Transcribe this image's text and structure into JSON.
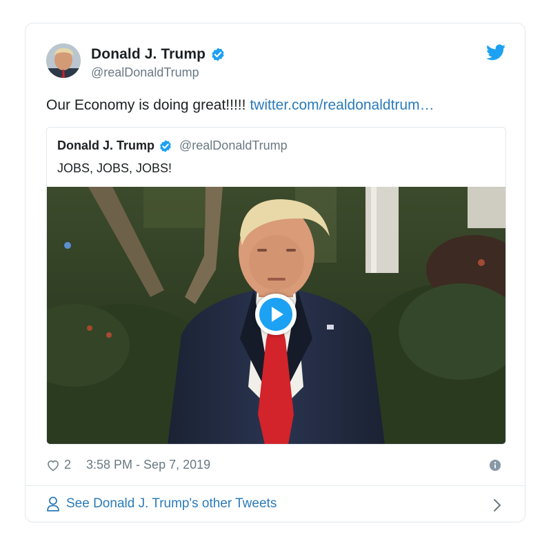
{
  "tweet": {
    "author_name": "Donald J. Trump",
    "author_handle": "@realDonaldTrump",
    "text": "Our Economy is doing great!!!!! ",
    "link_text": "twitter.com/realdonaldtrum…",
    "likes": "2",
    "timestamp": "3:58 PM - Sep 7, 2019",
    "other_tweets_label": "See Donald J. Trump's other Tweets"
  },
  "quoted_tweet": {
    "author_name": "Donald J. Trump",
    "author_handle": "@realDonaldTrump",
    "text": "JOBS, JOBS, JOBS!"
  },
  "colors": {
    "accent": "#1da1f2",
    "link": "#2b7bb9",
    "secondary_text": "#697882",
    "border": "#e1e8ed"
  },
  "icons": [
    "verified-badge-icon",
    "twitter-bird-icon",
    "play-icon",
    "heart-icon",
    "info-icon",
    "person-icon",
    "chevron-right-icon"
  ]
}
